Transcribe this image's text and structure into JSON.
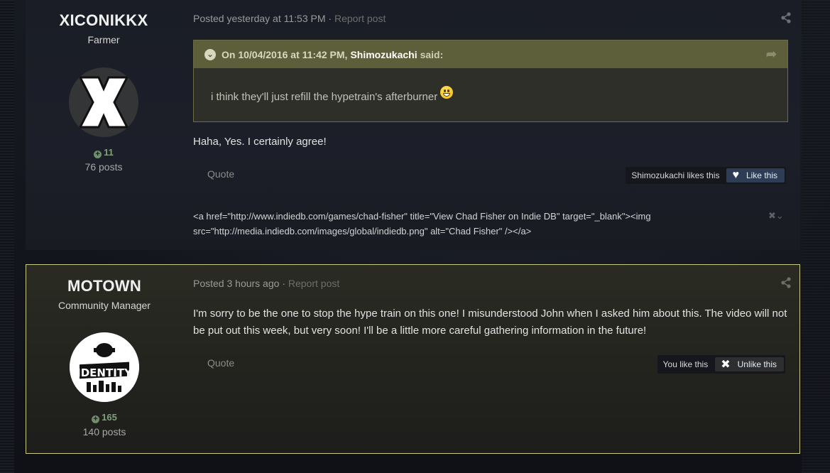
{
  "posts": [
    {
      "author": {
        "name": "XICONIKKX",
        "title": "Farmer",
        "reputation": "11",
        "post_count": "76 posts",
        "avatar_letter": "X"
      },
      "meta": {
        "posted": "Posted yesterday at 11:53 PM",
        "separator": "·",
        "report": "Report post"
      },
      "quote": {
        "toggle_icon": "chevron-down-icon",
        "date": "On 10/04/2016 at 11:42 PM,",
        "author": "Shimozukachi",
        "said": "said:",
        "text": "i think they'll just refill the hypetrain's afterburner"
      },
      "body": "Haha, Yes. I certainly agree!",
      "quote_label": "Quote",
      "likes_text": "Shimozukachi likes this",
      "like_button": "Like this",
      "signature": "<a href=\"http://www.indiedb.com/games/chad-fisher\" title=\"View Chad Fisher on Indie DB\" target=\"_blank\"><img src=\"http://media.indiedb.com/images/global/indiedb.png\" alt=\"Chad Fisher\" /></a>"
    },
    {
      "author": {
        "name": "MOTOWN",
        "title": "Community Manager",
        "reputation": "165",
        "post_count": "140 posts",
        "avatar_text": "IDENTITY"
      },
      "meta": {
        "posted": "Posted 3 hours ago",
        "separator": "·",
        "report": "Report post"
      },
      "body": "I'm sorry to be the one to stop the hype train on this one! I misunderstood John when I asked him about this. The video will not be put out this week, but very soon! I'll be a little more careful gathering information in the future!",
      "quote_label": "Quote",
      "likes_text": "You like this",
      "like_button": "Unlike this"
    }
  ],
  "colors": {
    "accent": "#5d5e3a",
    "highlight_border": "#c8c98a",
    "like_button": "#2e3d55",
    "reputation": "#7fa07a"
  }
}
